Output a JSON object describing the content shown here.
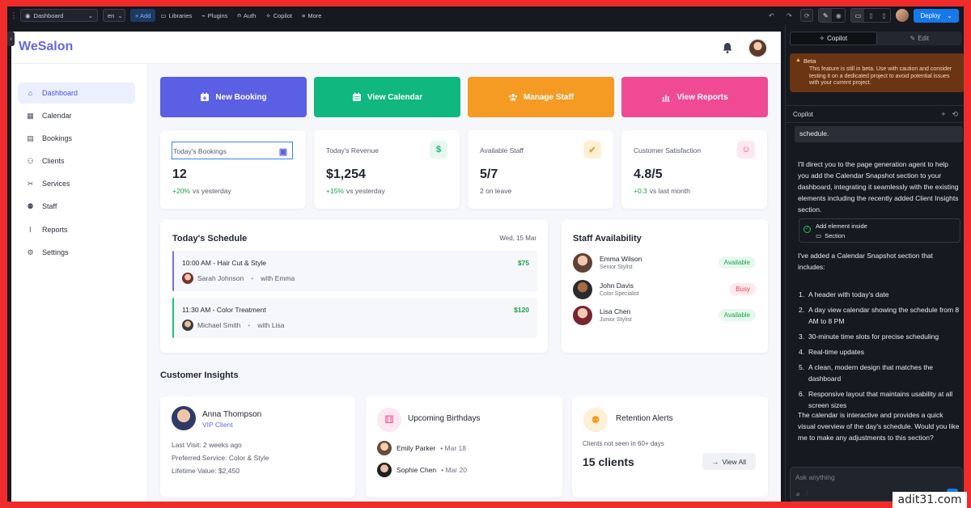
{
  "toolbar": {
    "page_select": "Dashboard",
    "lang_select": "en",
    "add_label": "+ Add",
    "libraries_label": "Libraries",
    "plugins_label": "Plugins",
    "auth_label": "Auth",
    "copilot_label": "Copilot",
    "more_label": "More",
    "deploy_label": "Deploy"
  },
  "app": {
    "logo": "WeSalon",
    "sidebar": [
      {
        "label": "Dashboard",
        "icon": "home-icon"
      },
      {
        "label": "Calendar",
        "icon": "calendar-icon"
      },
      {
        "label": "Bookings",
        "icon": "book-icon"
      },
      {
        "label": "Clients",
        "icon": "users-icon"
      },
      {
        "label": "Services",
        "icon": "scissors-icon"
      },
      {
        "label": "Staff",
        "icon": "user-icon"
      },
      {
        "label": "Reports",
        "icon": "chart-icon"
      },
      {
        "label": "Settings",
        "icon": "gear-icon"
      }
    ],
    "quick_actions": [
      {
        "label": "New Booking",
        "color": "#5b5fe3"
      },
      {
        "label": "View Calendar",
        "color": "#10b77f"
      },
      {
        "label": "Manage Staff",
        "color": "#f59a23"
      },
      {
        "label": "View Reports",
        "color": "#ef4a93"
      }
    ],
    "stats": [
      {
        "label": "Today's Bookings",
        "value": "12",
        "change": "+20%",
        "suffix": "vs yesterday"
      },
      {
        "label": "Today's Revenue",
        "value": "$1,254",
        "change": "+15%",
        "suffix": "vs yesterday"
      },
      {
        "label": "Available Staff",
        "value": "5/7",
        "change": "",
        "suffix": "2 on leave"
      },
      {
        "label": "Customer Satisfaction",
        "value": "4.8/5",
        "change": "+0.3",
        "suffix": "vs last month"
      }
    ],
    "schedule": {
      "title": "Today's Schedule",
      "date": "Wed, 15 Mar",
      "items": [
        {
          "title": "10:00 AM - Hair Cut & Style",
          "price": "$75",
          "client": "Sarah Johnson",
          "with": "with Emma",
          "color": "#7b6fe0"
        },
        {
          "title": "11:30 AM - Color Treatment",
          "price": "$120",
          "client": "Michael Smith",
          "with": "with Lisa",
          "color": "#22c07a"
        }
      ]
    },
    "staff": {
      "title": "Staff Availability",
      "items": [
        {
          "name": "Emma Wilson",
          "role": "Senior Stylist",
          "status": "Available"
        },
        {
          "name": "John Davis",
          "role": "Color Specialist",
          "status": "Busy"
        },
        {
          "name": "Lisa Chen",
          "role": "Junior Stylist",
          "status": "Available"
        }
      ]
    },
    "insights": {
      "title": "Customer Insights",
      "client": {
        "name": "Anna Thompson",
        "tag": "VIP Client",
        "last_visit": "Last Visit: 2 weeks ago",
        "service": "Preferred Service: Color & Style",
        "ltv": "Lifetime Value: $2,450"
      },
      "birthdays": {
        "title": "Upcoming Birthdays",
        "items": [
          {
            "name": "Emily Parker",
            "date": "• Mar 18"
          },
          {
            "name": "Sophie Chen",
            "date": "• Mar 20"
          }
        ]
      },
      "retention": {
        "title": "Retention Alerts",
        "text": "Clients not seen in 60+ days",
        "count": "15 clients",
        "button": "View All"
      }
    }
  },
  "copilot": {
    "tab_copilot": "Copilot",
    "tab_edit": "Edit",
    "beta_title": "Beta",
    "beta_text": "This feature is still in beta. Use with caution and consider testing it on a dedicated project to avoid potential issues with your current project.",
    "header": "Copilot",
    "user_msg": "schedule.",
    "msg1": "I'll direct you to the page generation agent to help you add the Calendar Snapshot section to your dashboard, integrating it seamlessly with the existing elements including the recently added Client Insights section.",
    "tool_title": "Add element inside",
    "tool_sub": "Section",
    "msg2": "I've added a Calendar Snapshot section that includes:",
    "list": [
      "A header with today's date",
      "A day view calendar showing the schedule from 8 AM to 8 PM",
      "30-minute time slots for precise scheduling",
      "Real-time updates",
      "A clean, modern design that matches the dashboard",
      "Responsive layout that maintains usability at all screen sizes"
    ],
    "msg3": "The calendar is interactive and provides a quick visual overview of the day's schedule. Would you like me to make any adjustments to this section?",
    "input_placeholder": "Ask anything"
  },
  "watermark": "adit31.com"
}
